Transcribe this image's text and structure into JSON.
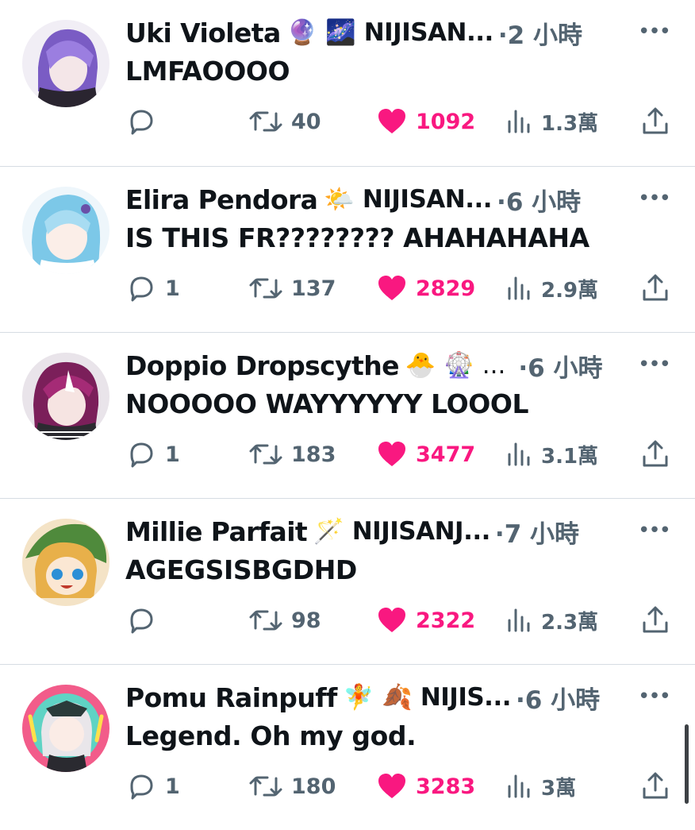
{
  "replies": [
    {
      "name": "Uki Violeta",
      "emojis": "🔮 🌌",
      "handle": "NIJISAN...",
      "dot_time": "·2 小時",
      "text": "LMFAOOOO",
      "reply_count": "",
      "retweets": "40",
      "likes": "1092",
      "views": "1.3萬"
    },
    {
      "name": "Elira Pendora",
      "emojis": "🌤️",
      "handle": "NIJISAN...",
      "dot_time": "·6 小時",
      "text": "IS THIS FR???????? AHAHAHAHA",
      "reply_count": "1",
      "retweets": "137",
      "likes": "2829",
      "views": "2.9萬"
    },
    {
      "name": "Doppio Dropscythe",
      "emojis": "🐣 🎡 ...",
      "handle": "",
      "dot_time": "·6 小時",
      "text": "NOOOOO WAYYYYYY LOOOL",
      "reply_count": "1",
      "retweets": "183",
      "likes": "3477",
      "views": "3.1萬"
    },
    {
      "name": "Millie Parfait",
      "emojis": "🪄",
      "handle": "NIJISANJ...",
      "dot_time": "·7 小時",
      "text": "AGEGSISBGDHD",
      "reply_count": "",
      "retweets": "98",
      "likes": "2322",
      "views": "2.3萬"
    },
    {
      "name": "Pomu Rainpuff",
      "emojis": "🧚 🍂",
      "handle": "NIJIS...",
      "dot_time": "·6 小時",
      "text": "Legend. Oh my god.",
      "reply_count": "1",
      "retweets": "180",
      "likes": "3283",
      "views": "3萬"
    }
  ],
  "icons": {
    "more": "more-icon",
    "reply": "reply-icon",
    "retweet": "retweet-icon",
    "like": "heart-icon",
    "views": "views-icon",
    "share": "share-icon"
  },
  "colors": {
    "text": "#0f1419",
    "secondary": "#536471",
    "like": "#f91880",
    "divider": "#d6dde3"
  }
}
